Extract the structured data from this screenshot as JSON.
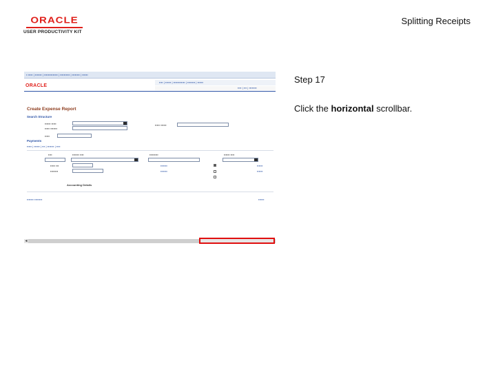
{
  "header": {
    "logo_text": "ORACLE",
    "logo_subtitle": "USER PRODUCTIVITY KIT",
    "slide_title": "Splitting Receipts"
  },
  "panel": {
    "step_label": "Step 17",
    "instruction_before": "Click the ",
    "instruction_bold": "horizontal",
    "instruction_after": " scrollbar."
  },
  "screenshot": {
    "logo_text": "ORACLE",
    "page_title": "Create Expense Report",
    "search_section": "Search Structure",
    "payments_section": "Payments",
    "detail_tab": "Details",
    "accounting_details": "Accounting Details",
    "scrollbar_arrow": "◄"
  },
  "colors": {
    "brand_red": "#e0201b",
    "highlight_red": "#e00d0d",
    "link_blue": "#2a52a6"
  }
}
